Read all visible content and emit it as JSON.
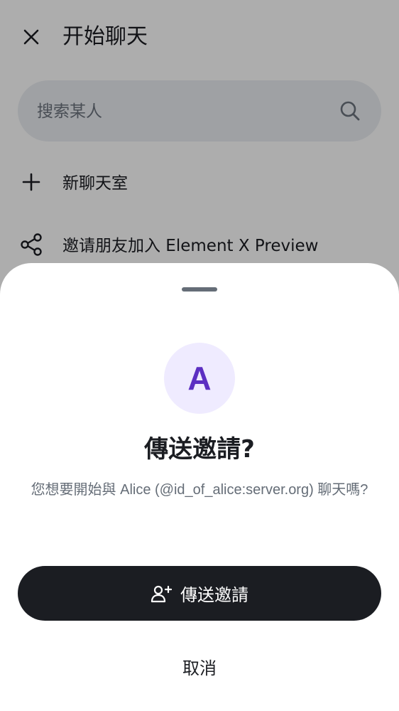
{
  "page": {
    "title": "开始聊天"
  },
  "search": {
    "placeholder": "搜索某人"
  },
  "list": {
    "items": [
      {
        "label": "新聊天室",
        "icon": "plus-icon"
      },
      {
        "label": "邀请朋友加入 Element X Preview",
        "icon": "share-icon"
      }
    ]
  },
  "dialog": {
    "avatar_letter": "A",
    "title": "傳送邀請?",
    "message": "您想要開始與 Alice (@id_of_alice:server.org) 聊天嗎?",
    "primary_label": "傳送邀請",
    "primary_icon": "invite-user-icon",
    "secondary_label": "取消"
  },
  "colors": {
    "primary_button": "#1b1d22",
    "avatar_bg": "#efebff",
    "avatar_text": "#5c2fc2",
    "scrim": "rgba(0,0,0,0.32)"
  }
}
